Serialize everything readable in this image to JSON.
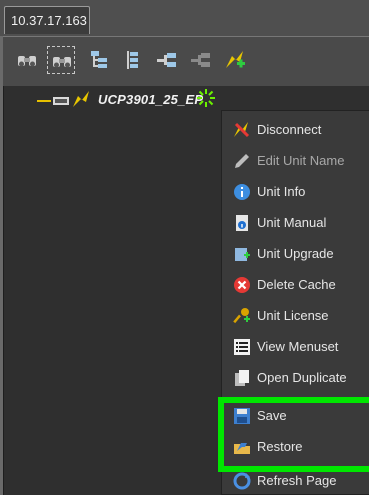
{
  "tab": {
    "label": "10.37.17.163"
  },
  "toolbar": {
    "buttons": [
      {
        "icon": "binoculars-icon"
      },
      {
        "icon": "binoculars-filter-icon"
      },
      {
        "icon": "expand-tree-icon"
      },
      {
        "icon": "collapse-tree-icon"
      },
      {
        "icon": "connect-icon"
      },
      {
        "icon": "network-gray-icon"
      },
      {
        "icon": "add-unit-icon"
      }
    ]
  },
  "tree": {
    "root_label": "UCP3901_25_EP"
  },
  "context_menu": {
    "items": [
      {
        "label": "Disconnect",
        "icon": "disconnect-icon",
        "enabled": true
      },
      {
        "label": "Edit Unit Name",
        "icon": "pencil-icon",
        "enabled": false
      },
      {
        "label": "Unit Info",
        "icon": "info-icon",
        "enabled": true
      },
      {
        "label": "Unit Manual",
        "icon": "manual-icon",
        "enabled": true
      },
      {
        "label": "Unit Upgrade",
        "icon": "upgrade-icon",
        "enabled": true
      },
      {
        "label": "Delete Cache",
        "icon": "delete-icon",
        "enabled": true
      },
      {
        "label": "Unit License",
        "icon": "key-icon",
        "enabled": true
      },
      {
        "label": "View Menuset",
        "icon": "list-icon",
        "enabled": true
      },
      {
        "label": "Open Duplicate",
        "icon": "duplicate-icon",
        "enabled": true
      },
      {
        "label": "Save",
        "icon": "save-icon",
        "enabled": true
      },
      {
        "label": "Restore",
        "icon": "restore-icon",
        "enabled": true
      },
      {
        "label": "Refresh Page",
        "icon": "refresh-icon",
        "enabled": true
      }
    ]
  },
  "colors": {
    "highlight": "#00e600",
    "tree_line": "#e6c000",
    "menu_bg": "#3a3a3a"
  }
}
